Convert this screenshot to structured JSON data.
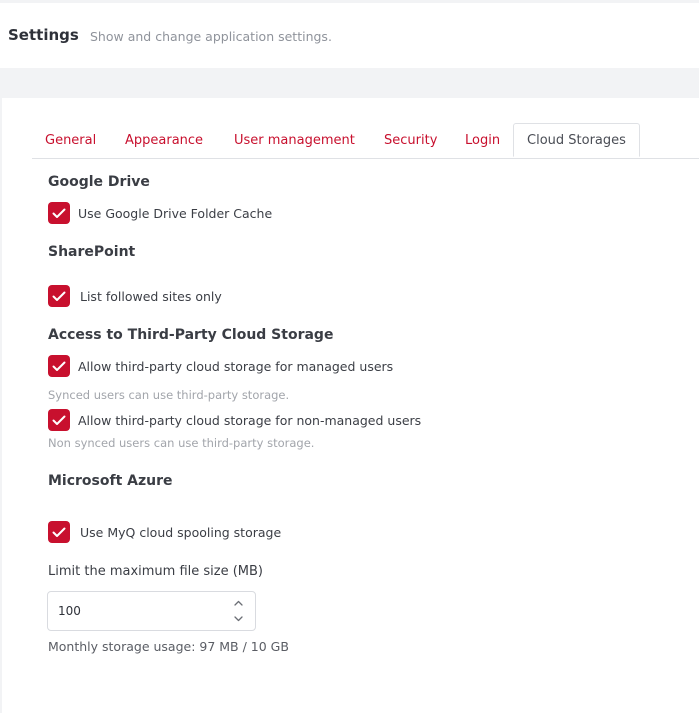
{
  "header": {
    "title": "Settings",
    "subtitle": "Show and change application settings."
  },
  "tabs": [
    {
      "label": "General",
      "active": false
    },
    {
      "label": "Appearance",
      "active": false
    },
    {
      "label": "User management",
      "active": false
    },
    {
      "label": "Security",
      "active": false
    },
    {
      "label": "Login",
      "active": false
    },
    {
      "label": "Cloud Storages",
      "active": true
    }
  ],
  "google_drive": {
    "title": "Google Drive",
    "folder_cache": {
      "label": "Use Google Drive Folder Cache",
      "checked": true
    }
  },
  "sharepoint": {
    "title": "SharePoint",
    "followed_sites": {
      "label": "List followed sites only",
      "checked": true
    }
  },
  "third_party": {
    "title": "Access to Third-Party Cloud Storage",
    "managed": {
      "label": "Allow third-party cloud storage for managed users",
      "checked": true,
      "hint": "Synced users can use third-party storage."
    },
    "non_managed": {
      "label": "Allow third-party cloud storage for non-managed users",
      "checked": true,
      "hint": "Non synced users can use third-party storage."
    }
  },
  "azure": {
    "title": "Microsoft Azure",
    "spooling": {
      "label": "Use MyQ cloud spooling storage",
      "checked": true
    },
    "max_file_size": {
      "label": "Limit the maximum file size (MB)",
      "value": "100"
    },
    "usage": "Monthly storage usage: 97 MB / 10 GB"
  },
  "colors": {
    "accent": "#c8102e",
    "background": "#f2f3f5"
  }
}
